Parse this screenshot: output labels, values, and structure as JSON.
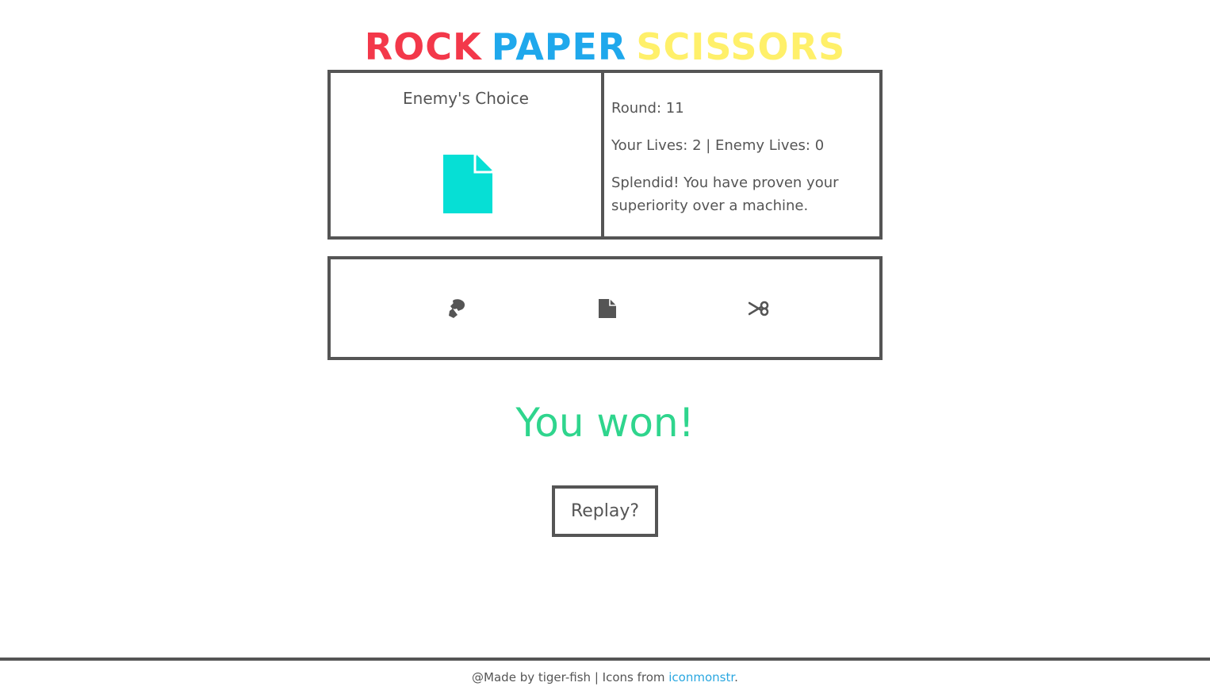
{
  "title": {
    "words": [
      "ROCK",
      "PAPER",
      "SCISSORS"
    ],
    "colors": [
      "#f3384a",
      "#1fa8ec",
      "#fff06a"
    ]
  },
  "enemy": {
    "label": "Enemy's Choice",
    "choice_icon": "paper-icon",
    "choice_color": "#06dfd5"
  },
  "status": {
    "round": "Round: 11",
    "lives": "Your Lives: 2 | Enemy Lives: 0",
    "message": "Splendid! You have proven your superiority over a machine."
  },
  "choices": [
    {
      "icon": "rock-icon"
    },
    {
      "icon": "paper-icon"
    },
    {
      "icon": "scissors-icon"
    }
  ],
  "result": {
    "text": "You won!",
    "color": "#2fd58d"
  },
  "replay_label": "Replay?",
  "footer": {
    "prefix": "@Made by tiger-fish | Icons from ",
    "link_text": "iconmonstr",
    "suffix": ".",
    "link_color": "#2aa7e0"
  }
}
